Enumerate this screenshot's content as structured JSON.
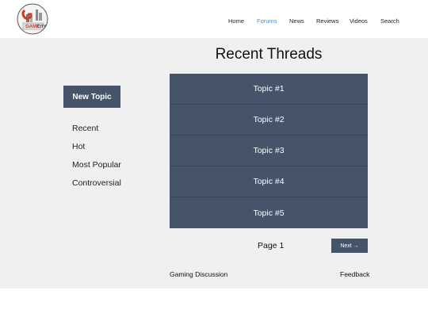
{
  "header": {
    "logo_text": "GAME CITY",
    "nav": [
      {
        "label": "Home",
        "active": false
      },
      {
        "label": "Forums",
        "active": true
      },
      {
        "label": "News",
        "active": false
      },
      {
        "label": "Reviews",
        "active": false
      },
      {
        "label": "Videos",
        "active": false
      },
      {
        "label": "Search",
        "active": false
      }
    ]
  },
  "main": {
    "title": "Recent Threads",
    "new_topic_label": "New Topic",
    "filters": [
      "Recent",
      "Hot",
      "Most Popular",
      "Controversial"
    ],
    "threads": [
      "Topic #1",
      "Topic #2",
      "Topic #3",
      "Topic #4",
      "Topic #5"
    ],
    "pagination": {
      "page_label": "Page 1",
      "next_label": "Next →"
    }
  },
  "footer": {
    "left_text": "Gaming Discussion",
    "right_link": "Feedback"
  },
  "colors": {
    "accent": "#455468",
    "nav_active": "#4f8ac8",
    "background": "#f0f0f0"
  }
}
